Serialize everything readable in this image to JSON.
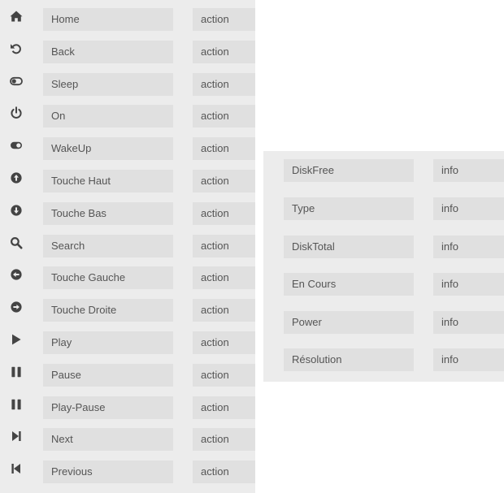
{
  "actions": [
    {
      "name": "Home",
      "type": "action",
      "icon": "home-icon"
    },
    {
      "name": "Back",
      "type": "action",
      "icon": "back-icon"
    },
    {
      "name": "Sleep",
      "type": "action",
      "icon": "toggle-off-icon"
    },
    {
      "name": "On",
      "type": "action",
      "icon": "power-icon"
    },
    {
      "name": "WakeUp",
      "type": "action",
      "icon": "toggle-on-icon"
    },
    {
      "name": "Touche Haut",
      "type": "action",
      "icon": "arrow-up-circle-icon"
    },
    {
      "name": "Touche Bas",
      "type": "action",
      "icon": "arrow-down-circle-icon"
    },
    {
      "name": "Search",
      "type": "action",
      "icon": "search-icon"
    },
    {
      "name": "Touche Gauche",
      "type": "action",
      "icon": "arrow-left-circle-icon"
    },
    {
      "name": "Touche Droite",
      "type": "action",
      "icon": "arrow-right-circle-icon"
    },
    {
      "name": "Play",
      "type": "action",
      "icon": "play-icon"
    },
    {
      "name": "Pause",
      "type": "action",
      "icon": "pause-icon"
    },
    {
      "name": "Play-Pause",
      "type": "action",
      "icon": "pause-icon"
    },
    {
      "name": "Next",
      "type": "action",
      "icon": "step-forward-icon"
    },
    {
      "name": "Previous",
      "type": "action",
      "icon": "step-backward-icon"
    }
  ],
  "infos": [
    {
      "name": "DiskFree",
      "type": "info"
    },
    {
      "name": "Type",
      "type": "info"
    },
    {
      "name": "DiskTotal",
      "type": "info"
    },
    {
      "name": "En Cours",
      "type": "info"
    },
    {
      "name": "Power",
      "type": "info"
    },
    {
      "name": "Résolution",
      "type": "info"
    }
  ],
  "colors": {
    "icon": "#444444",
    "field_background": "#e0e0e0",
    "panel_background": "#ececec",
    "text": "#555555"
  }
}
